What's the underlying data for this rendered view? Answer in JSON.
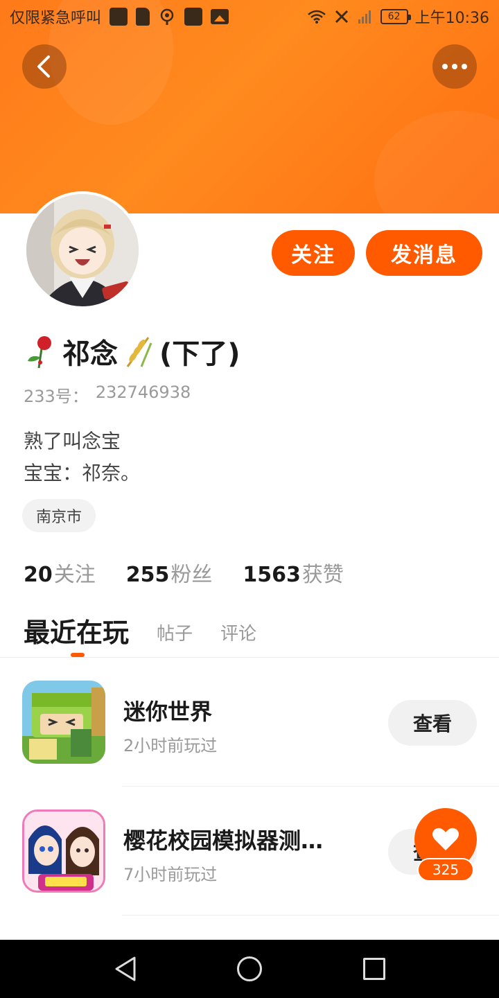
{
  "status_bar": {
    "carrier": "仅限紧急呼叫",
    "battery": "62",
    "time": "上午10:36"
  },
  "header": {
    "back_icon": "chevron-left-icon",
    "more_icon": "more-dots-icon"
  },
  "profile": {
    "name": "祁念",
    "name_suffix": "(下了)",
    "id_label": "233号：",
    "id_value": "232746938",
    "bio_line1": "熟了叫念宝",
    "bio_line2": "宝宝：祁奈。",
    "location": "南京市",
    "follow_label": "关注",
    "message_label": "发消息"
  },
  "stats": [
    {
      "num": "20",
      "label": "关注"
    },
    {
      "num": "255",
      "label": "粉丝"
    },
    {
      "num": "1563",
      "label": "获赞"
    }
  ],
  "tabs": [
    {
      "label": "最近在玩"
    },
    {
      "label": "帖子"
    },
    {
      "label": "评论"
    }
  ],
  "games": [
    {
      "title": "迷你世界",
      "subtitle": "2小时前玩过",
      "button": "查看"
    },
    {
      "title": "樱花校园模拟器测…",
      "subtitle": "7小时前玩过",
      "button": "查看"
    }
  ],
  "like": {
    "count": "325",
    "icon": "heart-icon"
  },
  "colors": {
    "accent": "#ff5a00",
    "banner": "#ff8a1e"
  }
}
